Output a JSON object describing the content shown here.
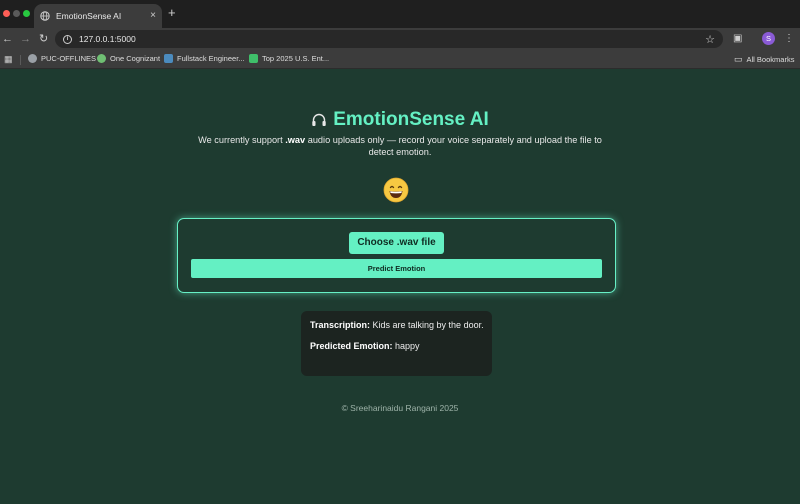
{
  "browser": {
    "tab_title": "EmotionSense AI",
    "tab_close": "×",
    "new_tab": "+",
    "url": "127.0.0.1:5000",
    "profile_initial": "S",
    "bookmarks": [
      {
        "label": "PUC-OFFLINES",
        "icon": "globe-icon",
        "color": "#9aa0a6"
      },
      {
        "label": "One Cognizant",
        "icon": "cognizant-icon",
        "color": "#6fbf73"
      },
      {
        "label": "Fullstack Engineer...",
        "icon": "python-icon",
        "color": "#4b8bbe"
      },
      {
        "label": "Top 2025 U.S. Ent...",
        "icon": "bookmark-site-icon",
        "color": "#3fbf6a"
      }
    ],
    "all_bookmarks": "All Bookmarks"
  },
  "app": {
    "title": "EmotionSense AI",
    "title_icon": "headphones-icon",
    "subtitle_pre": "We currently support ",
    "subtitle_bold": ".wav",
    "subtitle_post": " audio uploads only — record your voice separately and upload the file to detect emotion.",
    "emotion_emoji": "😄",
    "choose_button": "Choose .wav file",
    "predict_button": "Predict Emotion",
    "result": {
      "transcription_label": "Transcription:",
      "transcription_value": " Kids are talking by the door.",
      "emotion_label": "Predicted Emotion:",
      "emotion_value": " happy"
    },
    "footer": "© Sreeharinaidu Rangani 2025"
  },
  "colors": {
    "accent": "#64f0c3",
    "background": "#1e3b30",
    "result_bg": "#1c2420"
  }
}
